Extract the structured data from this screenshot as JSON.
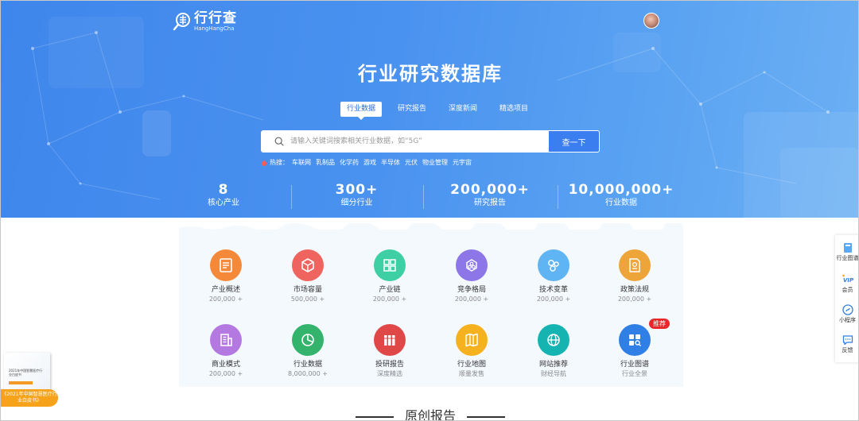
{
  "brand": {
    "name_cn": "行行查",
    "name_en": "HangHangCha"
  },
  "hero": {
    "title": "行业研究数据库",
    "tabs": [
      {
        "label": "行业数据",
        "active": true
      },
      {
        "label": "研究报告",
        "active": false
      },
      {
        "label": "深度新闻",
        "active": false
      },
      {
        "label": "精选项目",
        "active": false
      }
    ],
    "search": {
      "placeholder": "请输入关键词搜索相关行业数据，如“5G”",
      "button": "查一下"
    },
    "hot": {
      "label": "热搜：",
      "items": [
        "车联网",
        "乳制品",
        "化学药",
        "游戏",
        "半导体",
        "光伏",
        "物业管理",
        "元宇宙"
      ]
    },
    "stats": [
      {
        "num": "8",
        "label": "核心产业"
      },
      {
        "num": "300+",
        "label": "细分行业"
      },
      {
        "num": "200,000+",
        "label": "研究报告"
      },
      {
        "num": "10,000,000+",
        "label": "行业数据"
      }
    ]
  },
  "categories": [
    {
      "name": "产业概述",
      "sub": "200,000 +",
      "icon": "document-icon",
      "color": "#f5893a"
    },
    {
      "name": "市场容量",
      "sub": "500,000 +",
      "icon": "cube-icon",
      "color": "#f0645f"
    },
    {
      "name": "产业链",
      "sub": "200,000 +",
      "icon": "grid-icon",
      "color": "#3fcfa4"
    },
    {
      "name": "竞争格局",
      "sub": "200,000 +",
      "icon": "hexagon-icon",
      "color": "#8c76e8"
    },
    {
      "name": "技术变革",
      "sub": "200,000 +",
      "icon": "circles-icon",
      "color": "#5fb4f3"
    },
    {
      "name": "政策法规",
      "sub": "200,000 +",
      "icon": "certificate-icon",
      "color": "#eda53a"
    },
    {
      "name": "商业模式",
      "sub": "200,000 +",
      "icon": "building-icon",
      "color": "#b479e0"
    },
    {
      "name": "行业数据",
      "sub": "8,000,000 +",
      "icon": "pie-chart-icon",
      "color": "#33b36b"
    },
    {
      "name": "投研报告",
      "sub": "深度精选",
      "icon": "books-icon",
      "color": "#e04848"
    },
    {
      "name": "行业地图",
      "sub": "顺量发售",
      "icon": "map-icon",
      "color": "#f6b21e"
    },
    {
      "name": "网站推荐",
      "sub": "财经导航",
      "icon": "globe-icon",
      "color": "#16b4b0"
    },
    {
      "name": "行业图谱",
      "sub": "行业全景",
      "icon": "graph-search-icon",
      "color": "#2f7fe6",
      "badge": "推荐"
    }
  ],
  "sidebar": [
    {
      "label": "行业图谱",
      "icon": "book-icon"
    },
    {
      "label": "会员",
      "icon": "vip-icon",
      "mark": "VIP"
    },
    {
      "label": "小程序",
      "icon": "mini-program-icon"
    },
    {
      "label": "反馈",
      "icon": "chat-icon"
    }
  ],
  "promo": {
    "book_title": "2021年中国智慧医疗行业白皮书",
    "label": "《2021年中国智慧医疗行业白皮书》"
  },
  "section": {
    "title": "原创报告"
  },
  "colors": {
    "hero": "#4a92ef",
    "accent": "#3a7ef0",
    "panel": "#f4f9fe"
  }
}
